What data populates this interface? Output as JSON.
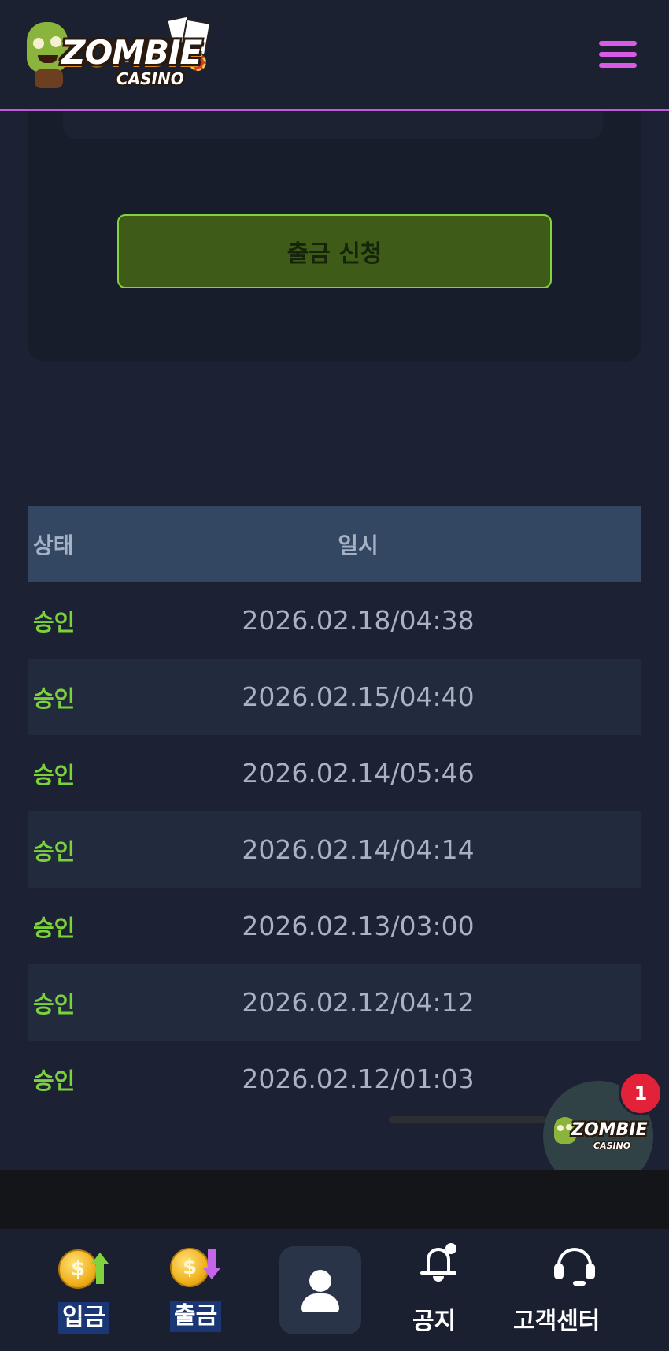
{
  "header": {
    "logo_text": "ZOMBIE",
    "logo_subtext": "CASINO",
    "menu_icon": "hamburger-menu-icon",
    "accent_color": "#d85be8"
  },
  "withdraw_form": {
    "submit_label": "출금 신청",
    "button_color": "#3f5b18",
    "button_border_color": "#82d43a"
  },
  "history_table": {
    "headers": {
      "status": "상태",
      "datetime": "일시"
    },
    "rows": [
      {
        "status": "승인",
        "datetime": "2026.02.18/04:38"
      },
      {
        "status": "승인",
        "datetime": "2026.02.15/04:40"
      },
      {
        "status": "승인",
        "datetime": "2026.02.14/05:46"
      },
      {
        "status": "승인",
        "datetime": "2026.02.14/04:14"
      },
      {
        "status": "승인",
        "datetime": "2026.02.13/03:00"
      },
      {
        "status": "승인",
        "datetime": "2026.02.12/04:12"
      },
      {
        "status": "승인",
        "datetime": "2026.02.12/01:03"
      }
    ],
    "status_color": "#7bd23a",
    "header_bg": "#334662"
  },
  "floating_chat": {
    "logo_text": "ZOMBIE",
    "logo_subtext": "CASINO",
    "badge_count": "1"
  },
  "bottom_nav": {
    "deposit": {
      "label": "입금",
      "icon": "coin-up-arrow-icon"
    },
    "withdraw": {
      "label": "출금",
      "icon": "coin-down-arrow-icon"
    },
    "profile": {
      "icon": "person-icon"
    },
    "notice": {
      "label": "공지",
      "icon": "bell-icon"
    },
    "support": {
      "label": "고객센터",
      "icon": "headset-icon"
    }
  }
}
